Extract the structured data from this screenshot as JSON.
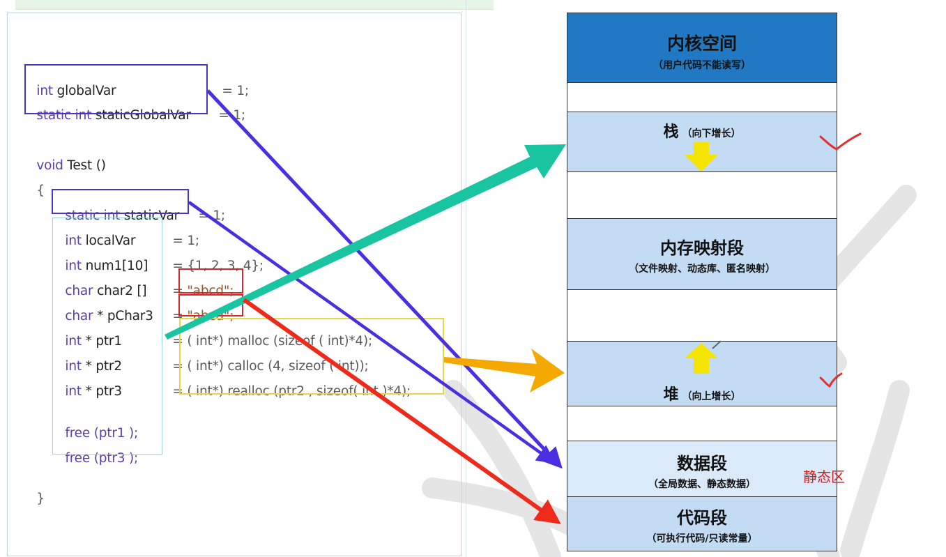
{
  "code": {
    "global_var": {
      "type": "int",
      "name": "globalVar",
      "init": "= 1;"
    },
    "static_global_var": {
      "type": "static int",
      "name": "staticGlobalVar",
      "init": "= 1;"
    },
    "func_decl": {
      "type": "void",
      "name": "Test ()"
    },
    "brace_open": "{",
    "static_var": {
      "type": "static int",
      "name": "staticVar",
      "init": "= 1;"
    },
    "local_var": {
      "type": "int",
      "name": "localVar",
      "init": "= 1;"
    },
    "num1": {
      "type": "int",
      "name": "num1[10]",
      "init": "= {1, 2, 3, 4};"
    },
    "char2": {
      "type": "char",
      "name": "char2 []",
      "eq": "=",
      "str": "\"abcd\";"
    },
    "pchar3": {
      "type": "char",
      "name": "* pChar3",
      "eq": "=",
      "str": "\"abcd\";"
    },
    "ptr1": {
      "type": "int",
      "name": "* ptr1",
      "init": "= ( int*) malloc (sizeof ( int)*4);"
    },
    "ptr2": {
      "type": "int",
      "name": "* ptr2",
      "init": "= ( int*) calloc (4, sizeof ( int));"
    },
    "ptr3": {
      "type": "int",
      "name": "* ptr3",
      "init": "= ( int*) realloc (ptr2 , sizeof( int )*4);"
    },
    "free1": "free (ptr1 );",
    "free3": "free (ptr3 );",
    "brace_close": "}"
  },
  "memory": {
    "kernel": {
      "title": "内核空间",
      "subtitle": "（用户代码不能读写）"
    },
    "stack": {
      "title": "栈",
      "subtitle": "（向下增长）"
    },
    "mmap": {
      "title": "内存映射段",
      "subtitle": "（文件映射、动态库、匿名映射）"
    },
    "heap": {
      "title": "堆",
      "subtitle": "（向上增长）"
    },
    "data": {
      "title": "数据段",
      "subtitle": "（全局数据、静态数据）"
    },
    "text": {
      "title": "代码段",
      "subtitle": "（可执行代码/只读常量）"
    }
  },
  "annotations": {
    "static_area": "静态区"
  },
  "colors": {
    "purple_arrow": "#4b2ee0",
    "teal_arrow": "#19c4a0",
    "orange_arrow": "#f5a800",
    "red_arrow": "#ee2a1a",
    "kernel_bg": "#2079c2",
    "segment_bg": "#c3dcf3"
  }
}
